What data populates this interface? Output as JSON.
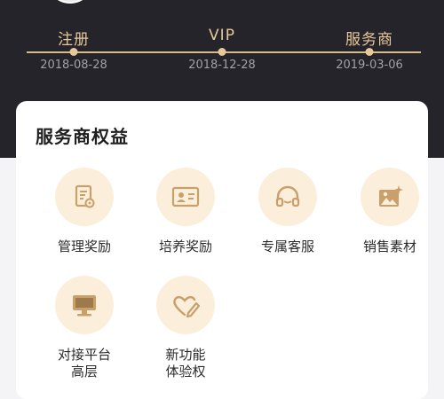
{
  "timeline": {
    "stages": [
      {
        "label": "注册",
        "date": "2018-08-28"
      },
      {
        "label": "VIP",
        "date": "2018-12-28"
      },
      {
        "label": "服务商",
        "date": "2019-03-06"
      }
    ]
  },
  "benefits_card": {
    "title": "服务商权益",
    "items": [
      {
        "label": "管理奖励",
        "icon": "document-gear-icon"
      },
      {
        "label": "培养奖励",
        "icon": "id-card-icon"
      },
      {
        "label": "专属客服",
        "icon": "headset-icon"
      },
      {
        "label": "销售素材",
        "icon": "image-sparkle-icon"
      },
      {
        "label": "对接平台\n高层",
        "icon": "monitor-icon"
      },
      {
        "label": "新功能\n体验权",
        "icon": "heart-pencil-icon"
      }
    ]
  },
  "colors": {
    "header_bg": "#25242a",
    "gold": "#e6c89b",
    "icon_bg": "#fbefdc",
    "icon_fg": "#c9a06a"
  }
}
